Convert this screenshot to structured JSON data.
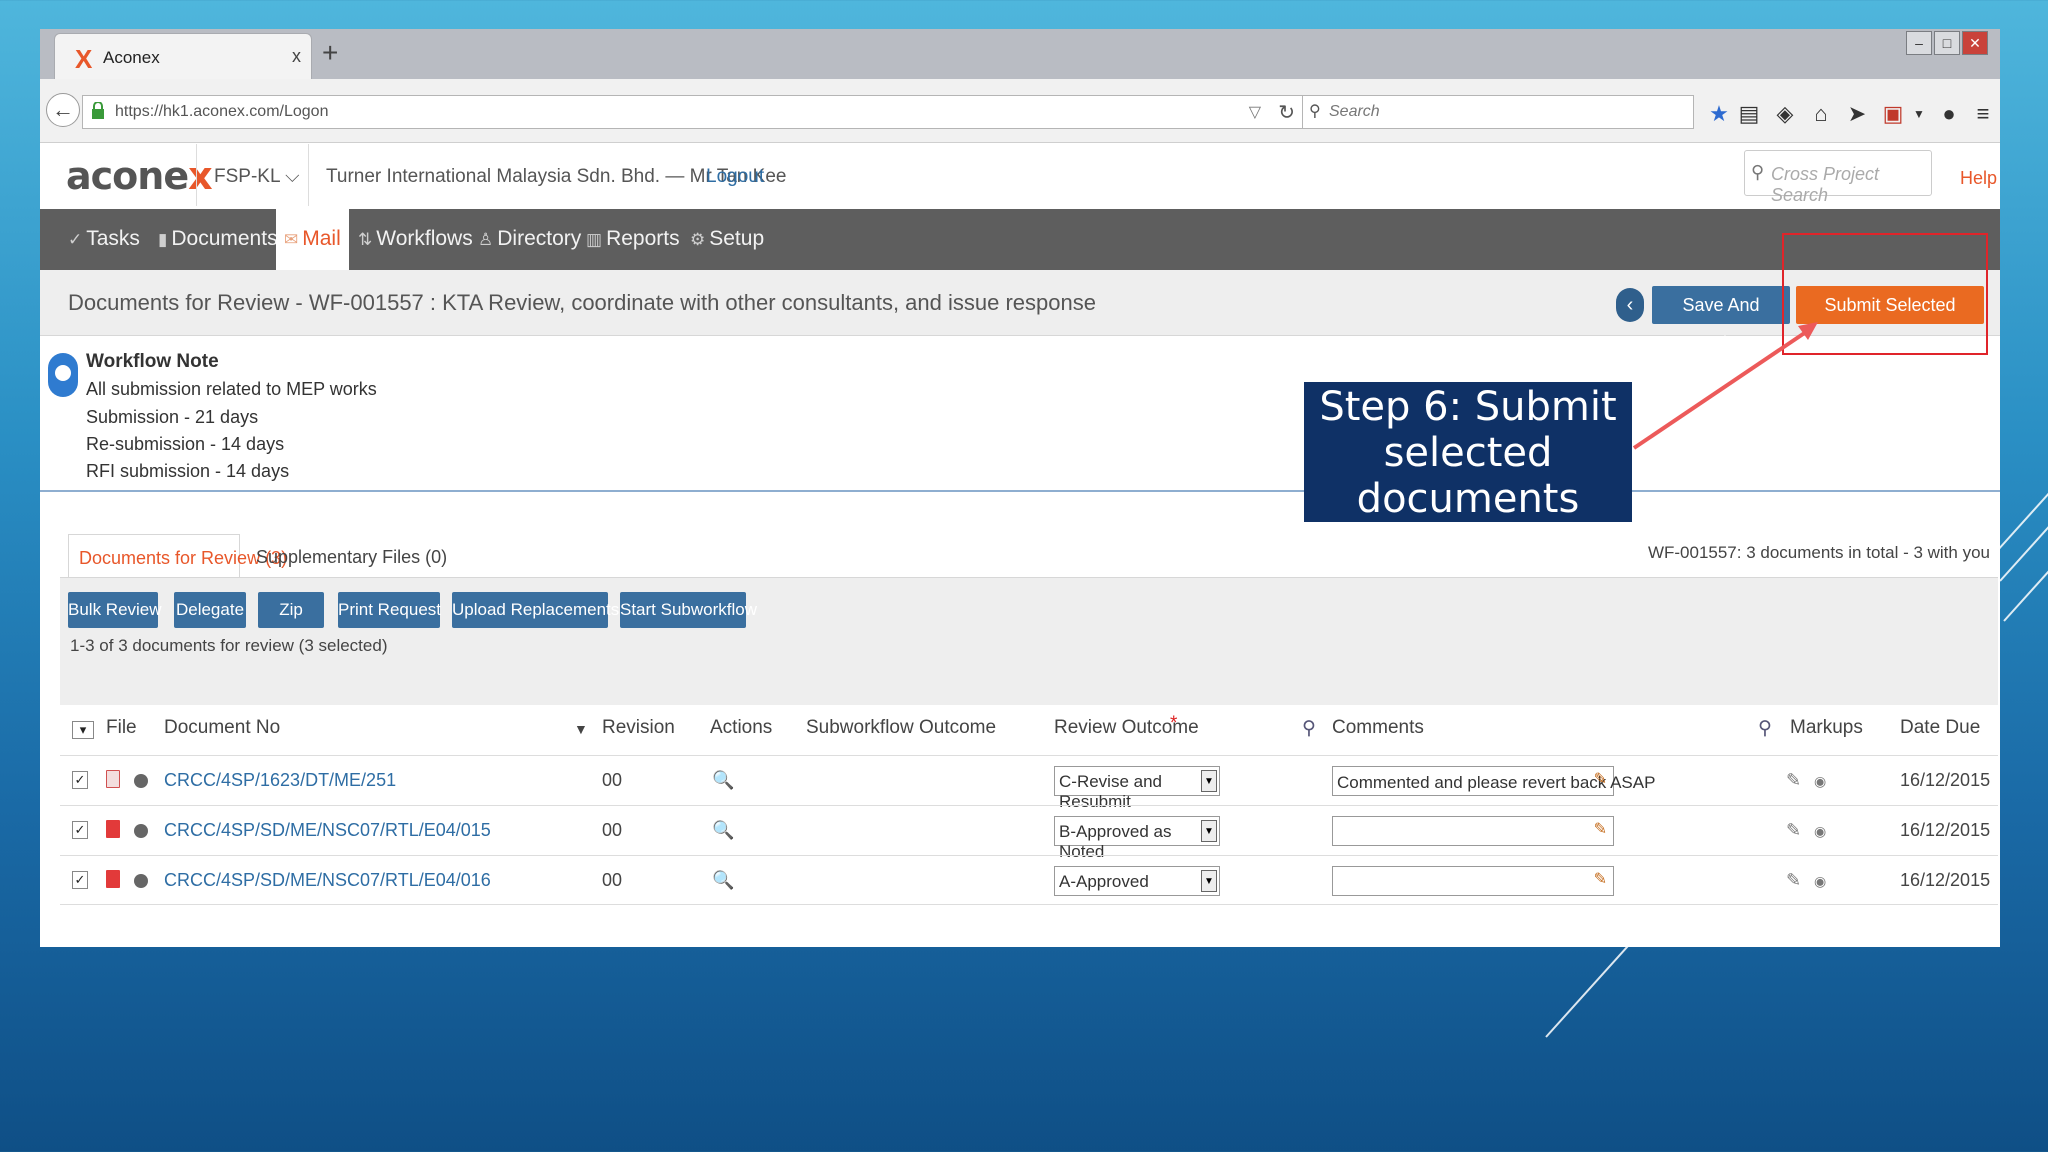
{
  "browser": {
    "tab_title": "Aconex",
    "tab_close": "x",
    "new_tab": "+",
    "url": "https://hk1.aconex.com/Logon",
    "search_placeholder": "Search"
  },
  "app": {
    "logo_text": "acone",
    "logo_x": "x",
    "project": "FSP-KL",
    "org_user": "Turner International Malaysia Sdn. Bhd. — Mr Tan Kee",
    "logout": "Logout",
    "cross_search_placeholder": "Cross Project Search",
    "help": "Help"
  },
  "nav": {
    "items": [
      {
        "label": "Tasks",
        "icon": "check-icon"
      },
      {
        "label": "Documents",
        "icon": "document-icon"
      },
      {
        "label": "Mail",
        "icon": "mail-icon"
      },
      {
        "label": "Workflows",
        "icon": "workflow-icon"
      },
      {
        "label": "Directory",
        "icon": "directory-icon"
      },
      {
        "label": "Reports",
        "icon": "reports-icon"
      },
      {
        "label": "Setup",
        "icon": "gear-icon"
      }
    ]
  },
  "page": {
    "title": "Documents for Review - WF-001557 : KTA Review, coordinate with other consultants, and issue response",
    "save_button": "Save And Continue",
    "submit_button": "Submit Selected Documents"
  },
  "workflow_note": {
    "heading": "Workflow Note",
    "lines": [
      "All submission related to MEP works",
      "Submission - 21 days",
      "Re-submission - 14 days",
      "RFI submission - 14 days"
    ]
  },
  "callout": {
    "line1": "Step 6: Submit",
    "line2": "selected",
    "line3": "documents"
  },
  "review": {
    "tab_active": "Documents for Review (3)",
    "tab_inactive": "Supplementary Files (0)",
    "count_summary": "WF-001557: 3 documents in total - 3  with you",
    "actions": [
      "Bulk Review",
      "Delegate",
      "Zip",
      "Print Request",
      "Upload Replacements",
      "Start Subworkflow"
    ],
    "selection_text": "1-3 of 3  documents for review  (3 selected)",
    "columns": {
      "file": "File",
      "document_no": "Document No",
      "revision": "Revision",
      "actions": "Actions",
      "subworkflow": "Subworkflow Outcome",
      "review_outcome": "Review Outcome",
      "required": "*",
      "comments": "Comments",
      "markups": "Markups",
      "date_due": "Date Due"
    },
    "rows": [
      {
        "doc_no": "CRCC/4SP/1623/DT/ME/251",
        "revision": "00",
        "outcome": "C-Revise and Resubmit",
        "comment": "Commented and please revert back ASAP",
        "date_due": "16/12/2015"
      },
      {
        "doc_no": "CRCC/4SP/SD/ME/NSC07/RTL/E04/015",
        "revision": "00",
        "outcome": "B-Approved as Noted",
        "comment": "",
        "date_due": "16/12/2015"
      },
      {
        "doc_no": "CRCC/4SP/SD/ME/NSC07/RTL/E04/016",
        "revision": "00",
        "outcome": "A-Approved",
        "comment": "",
        "date_due": "16/12/2015"
      }
    ]
  },
  "colors": {
    "accent": "#ea6a21",
    "primary_button": "#3a6f9f",
    "nav_bg": "#5e5e5e",
    "callout_bg": "#0f3166",
    "highlight": "#e0242a"
  }
}
